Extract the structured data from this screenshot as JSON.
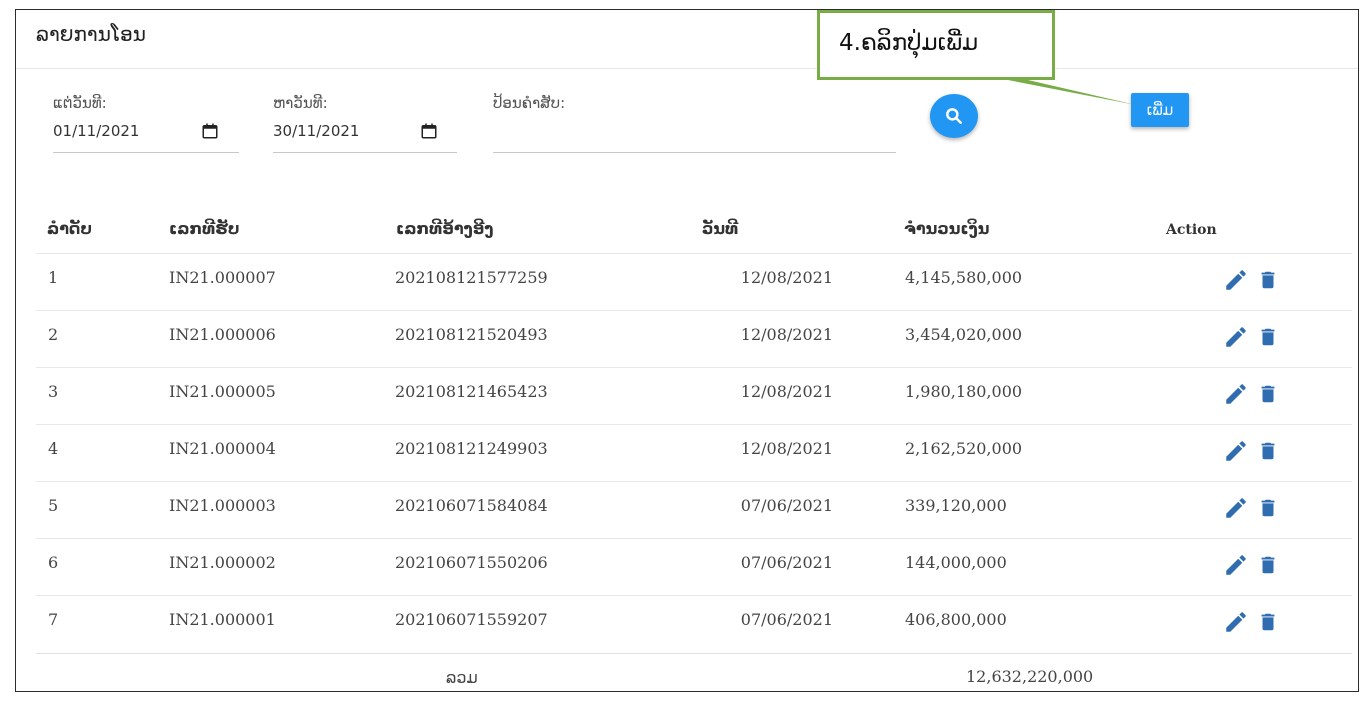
{
  "page": {
    "title": "ລາຍການໂອນ"
  },
  "filters": {
    "from_label": "ແຕ່ວັນທີ:",
    "from_value": "01/11/2021",
    "to_label": "ຫາວັນທີ:",
    "to_value": "30/11/2021",
    "keyword_label": "ປ້ອນຄຳສັບ:",
    "keyword_value": ""
  },
  "buttons": {
    "add_label": "ເພີ່ມ"
  },
  "callout": {
    "text": "4.ຄລິກປຸ່ມເພີ່ມ"
  },
  "table": {
    "headers": [
      "ລຳດັບ",
      "ເລກທີຮັບ",
      "ເລກທີອ້າງອີງ",
      "ວັນທີ",
      "ຈຳນວນເງິນ",
      "Action"
    ],
    "rows": [
      {
        "no": "1",
        "receipt": "IN21.000007",
        "ref": "202108121577259",
        "date": "12/08/2021",
        "amount": "4,145,580,000"
      },
      {
        "no": "2",
        "receipt": "IN21.000006",
        "ref": "202108121520493",
        "date": "12/08/2021",
        "amount": "3,454,020,000"
      },
      {
        "no": "3",
        "receipt": "IN21.000005",
        "ref": "202108121465423",
        "date": "12/08/2021",
        "amount": "1,980,180,000"
      },
      {
        "no": "4",
        "receipt": "IN21.000004",
        "ref": "202108121249903",
        "date": "12/08/2021",
        "amount": "2,162,520,000"
      },
      {
        "no": "5",
        "receipt": "IN21.000003",
        "ref": "202106071584084",
        "date": "07/06/2021",
        "amount": "339,120,000"
      },
      {
        "no": "6",
        "receipt": "IN21.000002",
        "ref": "202106071550206",
        "date": "07/06/2021",
        "amount": "144,000,000"
      },
      {
        "no": "7",
        "receipt": "IN21.000001",
        "ref": "202106071559207",
        "date": "07/06/2021",
        "amount": "406,800,000"
      }
    ],
    "total_label": "ລວມ",
    "total_value": "12,632,220,000"
  },
  "icons": {
    "calendar": "calendar-icon",
    "search": "search-icon",
    "edit": "pencil-icon",
    "delete": "trash-icon"
  },
  "colors": {
    "primary": "#2196f3",
    "action_icon": "#2f6db0",
    "callout_border": "#77ac46"
  }
}
